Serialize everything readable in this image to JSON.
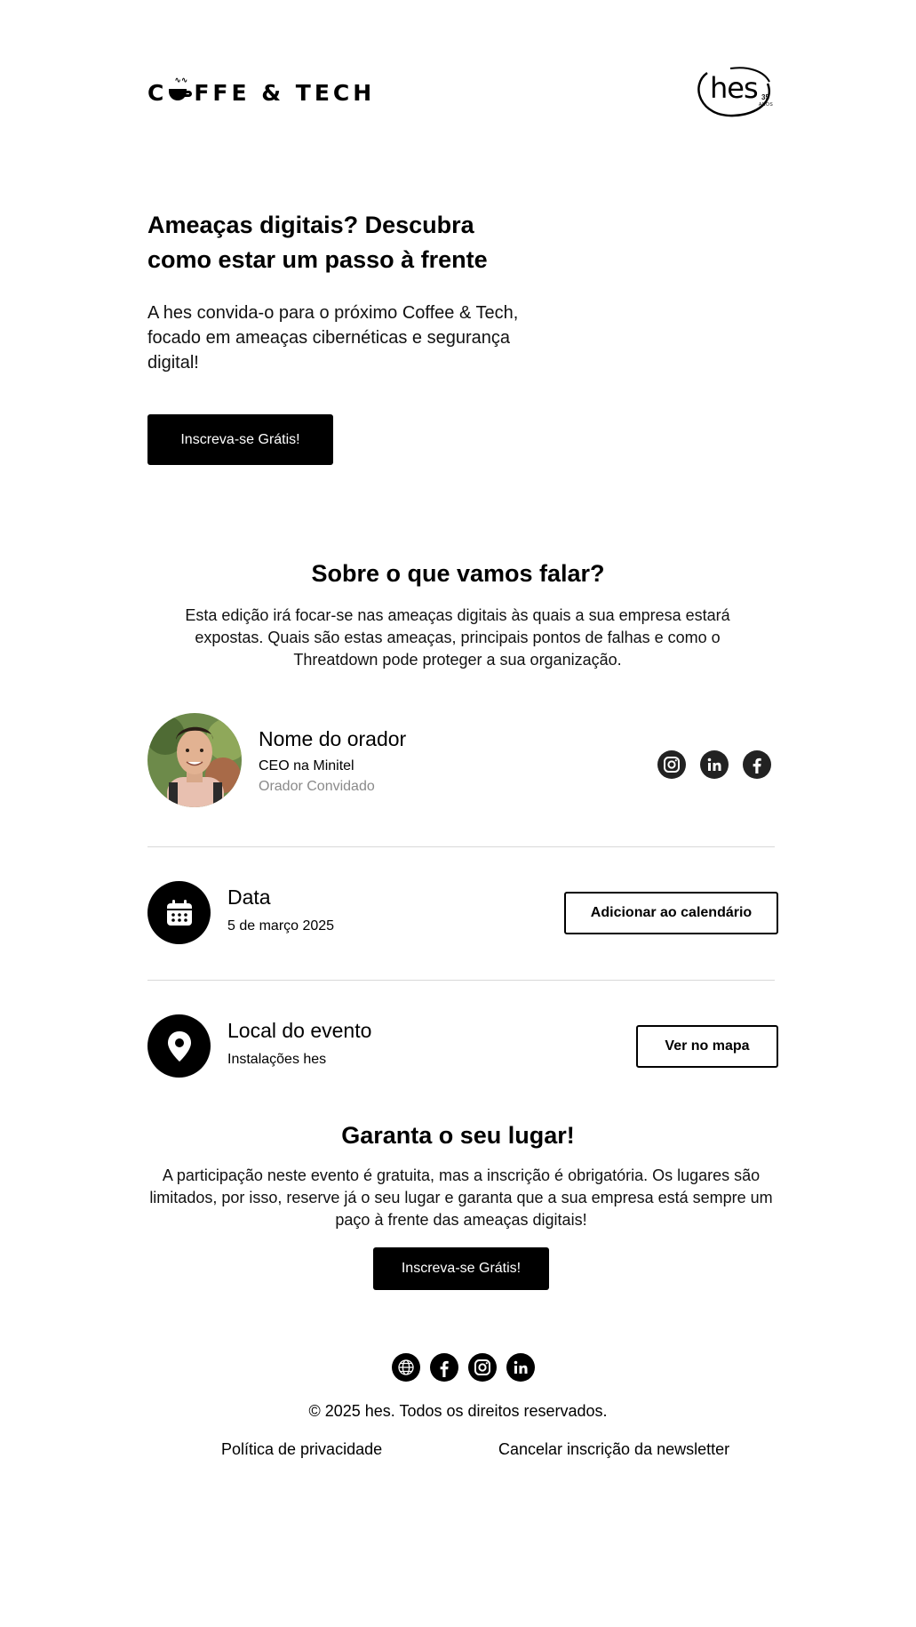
{
  "header": {
    "brand_logo_text": "C☕FFE & TECH",
    "brand_text_left": "C",
    "brand_text_right": "FFE & TECH",
    "partner_logo": {
      "word": "hes",
      "number": "35",
      "sub": "ANOS"
    }
  },
  "hero": {
    "title": "Ameaças digitais? Descubra como estar um passo à frente",
    "subtitle": "A hes convida-o para o próximo Coffee & Tech, focado em ameaças cibernéticas e segurança digital!",
    "cta_label": "Inscreva-se Grátis!"
  },
  "about": {
    "title": "Sobre o que vamos falar?",
    "text": "Esta edição irá focar-se nas ameaças digitais às quais a sua empresa estará expostas. Quais são estas ameaças, principais pontos de falhas e como o Threatdown pode proteger a sua organização."
  },
  "speaker": {
    "name": "Nome do orador",
    "role": "CEO na Minitel",
    "tag": "Orador Convidado",
    "socials": [
      "instagram-icon",
      "linkedin-icon",
      "facebook-icon"
    ]
  },
  "date": {
    "title": "Data",
    "value": "5 de março 2025",
    "button_label": "Adicionar ao calendário",
    "icon": "calendar-icon"
  },
  "location": {
    "title": "Local do evento",
    "value": "Instalações hes",
    "button_label": "Ver no mapa",
    "icon": "map-pin-icon"
  },
  "cta": {
    "title": "Garanta o seu lugar!",
    "text": "A participação neste evento é gratuita, mas a inscrição é obrigatória. Os lugares são limitados, por isso, reserve já o seu lugar e garanta que a sua empresa está sempre um paço à frente das ameaças digitais!",
    "button_label": "Inscreva-se Grátis!"
  },
  "footer": {
    "socials": [
      "globe-icon",
      "facebook-icon",
      "instagram-icon",
      "linkedin-icon"
    ],
    "copyright": "© 2025 hes. Todos os direitos reservados.",
    "privacy_link": "Política de privacidade",
    "unsubscribe_link": "Cancelar inscrição da newsletter"
  },
  "colors": {
    "primary": "#000000",
    "background": "#ffffff",
    "muted_text": "#8a8a8a",
    "divider": "#d9d9d9",
    "social_circle": "#222222"
  }
}
